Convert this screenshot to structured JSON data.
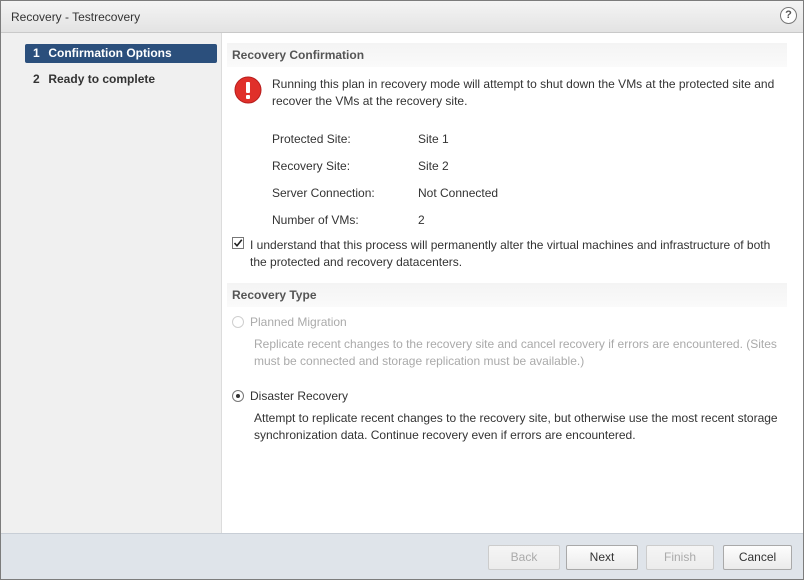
{
  "dialog": {
    "title": "Recovery - Testrecovery",
    "help_symbol": "?"
  },
  "steps": [
    {
      "num": "1",
      "label": "Confirmation Options",
      "active": true
    },
    {
      "num": "2",
      "label": "Ready to complete",
      "active": false
    }
  ],
  "confirmation": {
    "header": "Recovery Confirmation",
    "warning_text": "Running this plan in recovery mode will attempt to shut down the VMs at the protected site and recover the VMs at the recovery site.",
    "properties": [
      {
        "label": "Protected Site:",
        "value": "Site 1"
      },
      {
        "label": "Recovery Site:",
        "value": "Site 2"
      },
      {
        "label": "Server Connection:",
        "value": "Not Connected"
      },
      {
        "label": "Number of VMs:",
        "value": "2"
      }
    ],
    "acknowledge_text": "I understand that this process will permanently alter the virtual machines and infrastructure of both the protected and recovery datacenters.",
    "acknowledge_checked": true
  },
  "recovery_type": {
    "header": "Recovery Type",
    "options": [
      {
        "label": "Planned Migration",
        "description": "Replicate recent changes to the recovery site and cancel recovery if errors are encountered. (Sites must be connected and storage replication must be available.)",
        "enabled": false,
        "selected": false
      },
      {
        "label": "Disaster Recovery",
        "description": "Attempt to replicate recent changes to the recovery site, but otherwise use the most recent storage synchronization data. Continue recovery even if errors are encountered.",
        "enabled": true,
        "selected": true
      }
    ]
  },
  "footer": {
    "back_label": "Back",
    "next_label": "Next",
    "finish_label": "Finish",
    "cancel_label": "Cancel"
  },
  "colors": {
    "active_step": "#2b4f7c",
    "warning_red": "#e0302a",
    "footer_bg": "#dfe4ea"
  }
}
